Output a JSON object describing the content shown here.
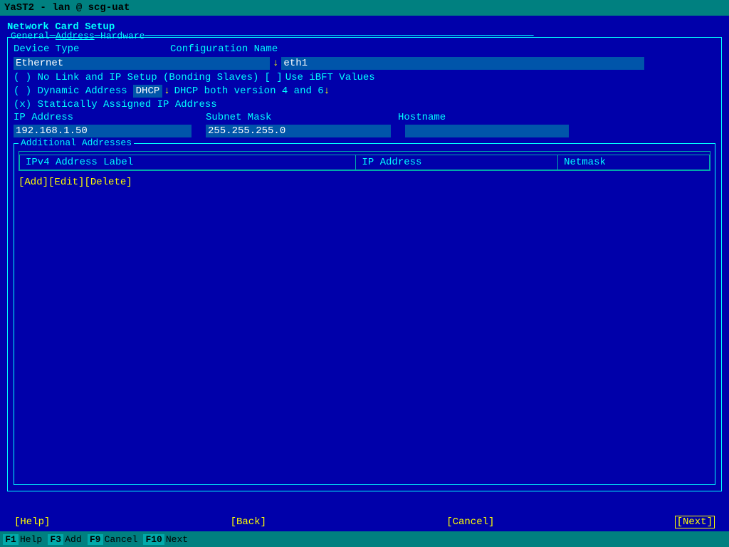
{
  "titlebar": {
    "text": "YaST2 - lan @ scg-uat"
  },
  "page_title": "Network Card Setup",
  "tabs": [
    {
      "label": "General",
      "active": false
    },
    {
      "label": "Address",
      "active": true
    },
    {
      "label": "Hardware",
      "active": false
    }
  ],
  "form": {
    "device_type_label": "Device Type",
    "device_type_value": "Ethernet",
    "config_name_label": "Configuration Name",
    "config_name_value": "eth1",
    "radio_no_link": "( ) No Link and IP Setup (Bonding Slaves)",
    "ibft_bracket_open": "[ ]",
    "ibft_label": "Use iBFT Values",
    "radio_dynamic": "( ) Dynamic Address",
    "dhcp_value": "DHCP",
    "dhcp_suffix": "DHCP both version 4 and 6",
    "dhcp_arrow": "↓",
    "radio_static": "(x) Statically Assigned IP Address",
    "ip_label": "IP Address",
    "ip_value": "192.168.1.50",
    "subnet_label": "Subnet Mask",
    "subnet_value": "255.255.255.0",
    "hostname_label": "Hostname"
  },
  "additional_addresses": {
    "label": "Additional Addresses",
    "table_headers": [
      "IPv4 Address Label",
      "IP Address",
      "Netmask"
    ],
    "table_rows": [],
    "buttons": {
      "add": "[Add]",
      "edit": "[Edit]",
      "delete": "[Delete]"
    }
  },
  "bottom_nav": {
    "help": "[Help]",
    "back": "[Back]",
    "cancel": "[Cancel]",
    "next": "[Next]"
  },
  "fkeys": [
    {
      "key": "F1",
      "label": "Help"
    },
    {
      "key": "F3",
      "label": "Add"
    },
    {
      "key": "F9",
      "label": "Cancel"
    },
    {
      "key": "F10",
      "label": "Next"
    }
  ]
}
